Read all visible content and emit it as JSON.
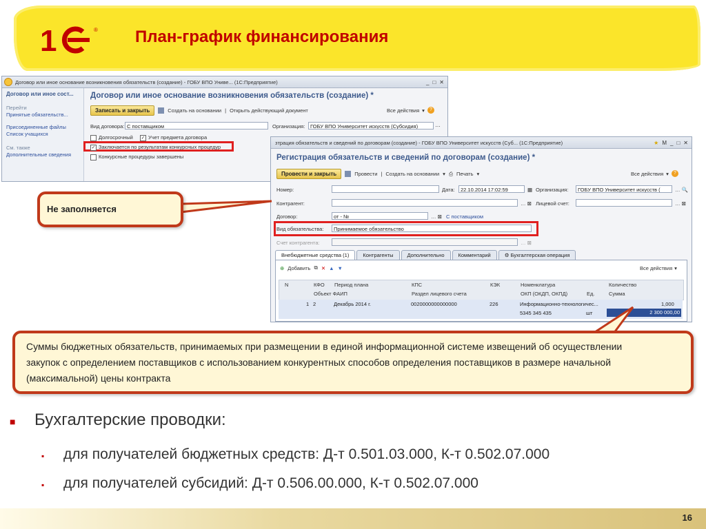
{
  "slide": {
    "title": "План-график финансирования",
    "page_number": "16"
  },
  "window1": {
    "titlebar": "Договор или иное основание возникновения обязательств (создание) - ГОБУ ВПО Униве... (1С:Предприятие)",
    "sidebar": {
      "heading": "Договор или иное сост...",
      "goto_label": "Перейти",
      "goto_item": "Принятые обязательств...",
      "links": [
        "Присоединенные файлы",
        "Список учащихся"
      ],
      "see_also_label": "См. также",
      "see_also_item": "Дополнительные сведения"
    },
    "form_title": "Договор или иное основание возникновения обязательств (создание) *",
    "buttons": {
      "save_close": "Записать и закрыть",
      "create_base": "Создать на основании",
      "open_doc": "Открыть действующий документ",
      "all_actions": "Все действия"
    },
    "fields": {
      "contract_type_label": "Вид договора:",
      "contract_type_value": "С поставщиком",
      "org_label": "Организация:",
      "org_value": "ГОБУ ВПО Университет искусств (Субсидия)"
    },
    "checkboxes": [
      {
        "label": "Долгосрочный",
        "checked": false
      },
      {
        "label": "Учет предмета договора",
        "checked": true
      },
      {
        "label": "Заключается по результатам конкурсных процедур",
        "checked": true
      },
      {
        "label": "Конкурсные процедуры завершены",
        "checked": false
      }
    ]
  },
  "window2": {
    "titlebar": "зтрация обязательств и сведений по договорам (создание) - ГОБУ ВПО Университет искусств (Суб... (1С:Предприятие)",
    "form_title": "Регистрация обязательств и сведений по договорам (создание) *",
    "buttons": {
      "post_close": "Провести и закрыть",
      "post": "Провести",
      "create_base": "Создать на основании",
      "print": "Печать",
      "all_actions": "Все действия"
    },
    "fields": {
      "number_label": "Номер:",
      "date_label": "Дата:",
      "date_value": "22.10.2014 17:02:59",
      "org_label": "Организация:",
      "org_value": "ГОБУ ВПО Университет искусств (",
      "counterparty_label": "Контрагент:",
      "account_label": "Лицевой счет:",
      "contract_label": "Договор:",
      "contract_value": "от - №",
      "contract_link": "С поставщиком",
      "obligation_type_label": "Вид обязательства:",
      "obligation_type_value": "Принимаемое обязательство",
      "counterparty_account_label": "Счет контрагента:"
    },
    "tabs": [
      "Внебюджетные средства (1)",
      "Контрагенты",
      "Дополнительно",
      "Комментарий",
      "Бухгалтерская операция"
    ],
    "table_toolbar": {
      "add": "Добавить",
      "all_actions": "Все действия"
    },
    "columns_row1": [
      "N",
      "КФО",
      "Период плана",
      "КПС",
      "КЭК",
      "Номенклатура",
      "Количество"
    ],
    "columns_row2": [
      "Объект ФАИП",
      "Раздел лицевого счета",
      "ОКП (ОКДП, ОКПД)",
      "Ед.",
      "Сумма"
    ],
    "row": {
      "n": "1",
      "kfo": "2",
      "period": "Декабрь 2014 г.",
      "kps": "0020000000000000",
      "kek": "226",
      "nomenclature": "Информационно-технологичес...",
      "quantity": "1,000",
      "okp": "5345 345 435",
      "unit": "шт",
      "sum": "2 300 000,00"
    }
  },
  "callouts": {
    "not_filled": "Не заполняется",
    "sums_text": "Суммы бюджетных обязательств, принимаемых при размещении в единой информационной системе извещений об осуществлении закупок с определением поставщиков с использованием конкурентных способов определения поставщиков  в размере начальной (максимальной) цены контракта"
  },
  "bullets": {
    "main": "Бухгалтерские проводки:",
    "sub": [
      "для получателей бюджетных средств: Д-т 0.501.03.000, К-т 0.502.07.000",
      "для получателей субсидий: Д-т 0.506.00.000, К-т 0.502.07.000"
    ]
  },
  "colors": {
    "title_red": "#c00000",
    "highlight_yellow": "#fbe52a",
    "callout_border": "#c0391a",
    "form_red_box": "#e02020",
    "selected_cell": "#2c4f96"
  }
}
